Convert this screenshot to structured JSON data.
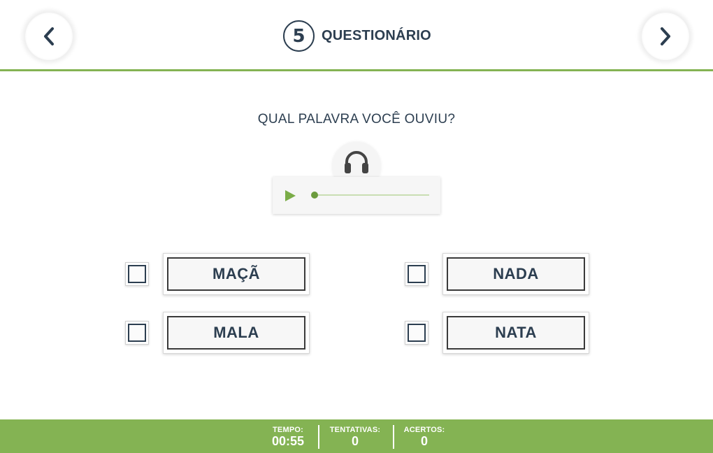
{
  "header": {
    "prev_icon": "chevron-left-icon",
    "next_icon": "chevron-right-icon",
    "step_number": "5",
    "title": "QUESTIONÁRIO"
  },
  "question": {
    "text": "QUAL PALAVRA VOCÊ OUVIU?"
  },
  "audio": {
    "icon": "headphones-icon",
    "play_icon": "play-icon",
    "progress": 0
  },
  "options": [
    {
      "label": "MAÇÃ",
      "checked": false
    },
    {
      "label": "NADA",
      "checked": false
    },
    {
      "label": "MALA",
      "checked": false
    },
    {
      "label": "NATA",
      "checked": false
    }
  ],
  "footer": {
    "tempo_label": "TEMPO:",
    "tempo_value": "00:55",
    "tentativas_label": "TENTATIVAS:",
    "tentativas_value": "0",
    "acertos_label": "ACERTOS:",
    "acertos_value": "0"
  },
  "colors": {
    "accent_green": "#84b353",
    "dark_navy": "#2c3e50",
    "play_green": "#7aac47"
  }
}
